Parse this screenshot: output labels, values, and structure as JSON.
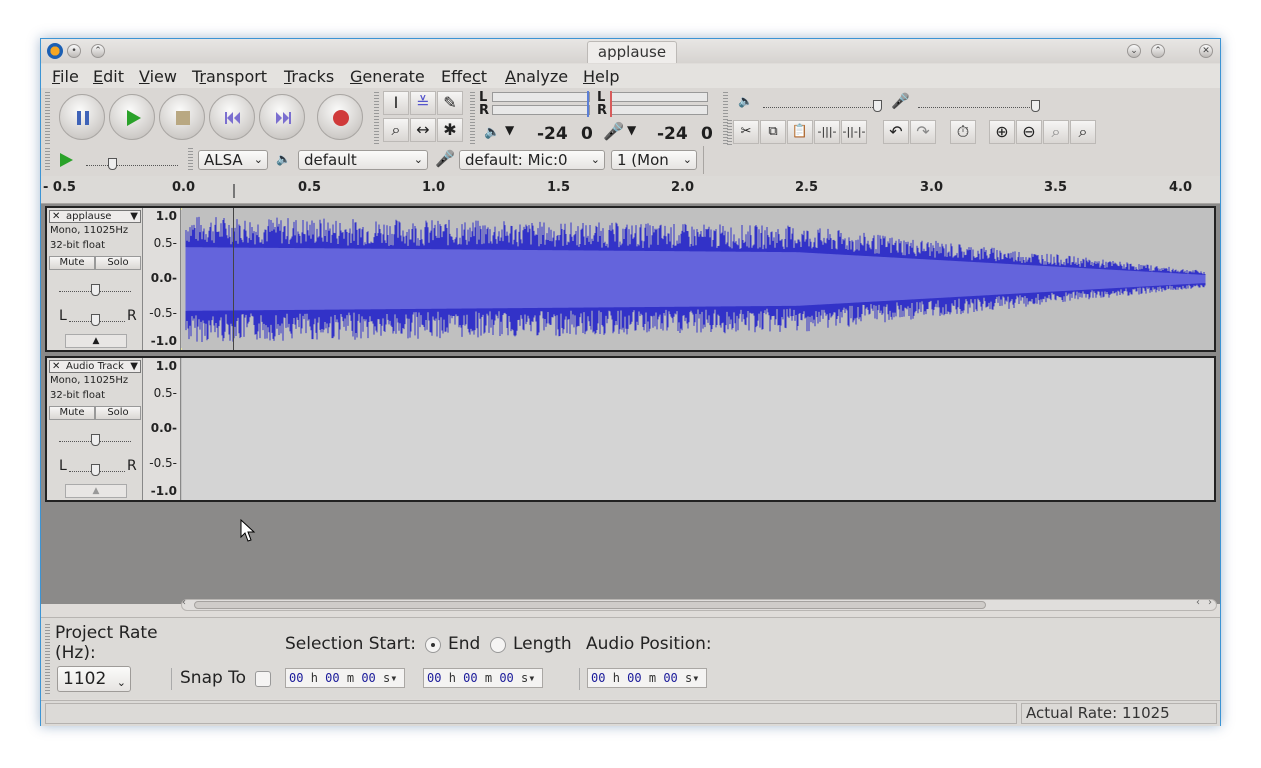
{
  "window": {
    "title": "applause"
  },
  "menu": [
    "File",
    "Edit",
    "View",
    "Transport",
    "Tracks",
    "Generate",
    "Effect",
    "Analyze",
    "Help"
  ],
  "menu_underline": [
    "F",
    "E",
    "V",
    "r",
    "T",
    "G",
    "c",
    "A",
    "H"
  ],
  "meters": {
    "playback_db": "-24",
    "playback_zero": "0",
    "record_db": "-24",
    "record_zero": "0",
    "left": "L",
    "right": "R"
  },
  "device": {
    "host": "ALSA",
    "playback": "default",
    "recording": "default: Mic:0",
    "channels": "1 (Mon"
  },
  "ruler": {
    "ticks": [
      "- 0.5",
      "0.0",
      "0.5",
      "1.0",
      "1.5",
      "2.0",
      "2.5",
      "3.0",
      "3.5",
      "4.0"
    ]
  },
  "tracks": [
    {
      "name": "applause",
      "info1": "Mono, 11025Hz",
      "info2": "32-bit float",
      "mute": "Mute",
      "solo": "Solo",
      "scale": [
        "1.0",
        "0.5-",
        "0.0-",
        "-0.5-",
        "-1.0"
      ],
      "pan_l": "L",
      "pan_r": "R"
    },
    {
      "name": "Audio Track",
      "info1": "Mono, 11025Hz",
      "info2": "32-bit float",
      "mute": "Mute",
      "solo": "Solo",
      "scale": [
        "1.0",
        "0.5-",
        "0.0-",
        "-0.5-",
        "-1.0"
      ],
      "pan_l": "L",
      "pan_r": "R"
    }
  ],
  "selection": {
    "project_rate_label": "Project Rate",
    "project_rate_unit": "(Hz):",
    "project_rate": "1102",
    "snap_to": "Snap To",
    "selection_start": "Selection Start:",
    "end": "End",
    "length": "Length",
    "audio_position": "Audio Position:",
    "time_hh": "00",
    "time_mm": "00",
    "time_ss": "00",
    "h": "h",
    "m": "m",
    "s": "s"
  },
  "status": {
    "actual_rate": "Actual Rate: 11025"
  },
  "colors": {
    "waveform": "#3232c8",
    "waveform_rms": "#6464dc",
    "track_bg": "#c0c0c0",
    "selected_border": "#e6e6a0"
  }
}
